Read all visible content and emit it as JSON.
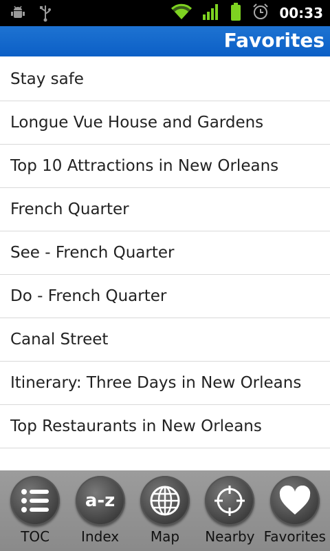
{
  "status_bar": {
    "time": "00:33",
    "icons": [
      "android-debug-icon",
      "usb-icon",
      "wifi-icon",
      "signal-icon",
      "battery-icon",
      "alarm-icon"
    ]
  },
  "header": {
    "title": "Favorites"
  },
  "favorites": [
    "Stay safe",
    "Longue Vue House and Gardens",
    "Top 10 Attractions in New Orleans",
    "French Quarter",
    "See - French Quarter",
    "Do - French Quarter",
    "Canal Street",
    "Itinerary: Three Days in New Orleans",
    "Top Restaurants in New Orleans"
  ],
  "toolbar": {
    "toc": {
      "label": "TOC",
      "icon": "list-icon"
    },
    "index": {
      "label": "Index",
      "icon": "a-z",
      "glyph": "a-z"
    },
    "map": {
      "label": "Map",
      "icon": "globe-icon"
    },
    "nearby": {
      "label": "Nearby",
      "icon": "crosshair-icon"
    },
    "favorites": {
      "label": "Favorites",
      "icon": "heart-icon"
    }
  },
  "colors": {
    "accent": "#0b5fc6",
    "status_bar": "#000000",
    "toolbar": "#8f8f8f",
    "wifi": "#7ed321"
  }
}
